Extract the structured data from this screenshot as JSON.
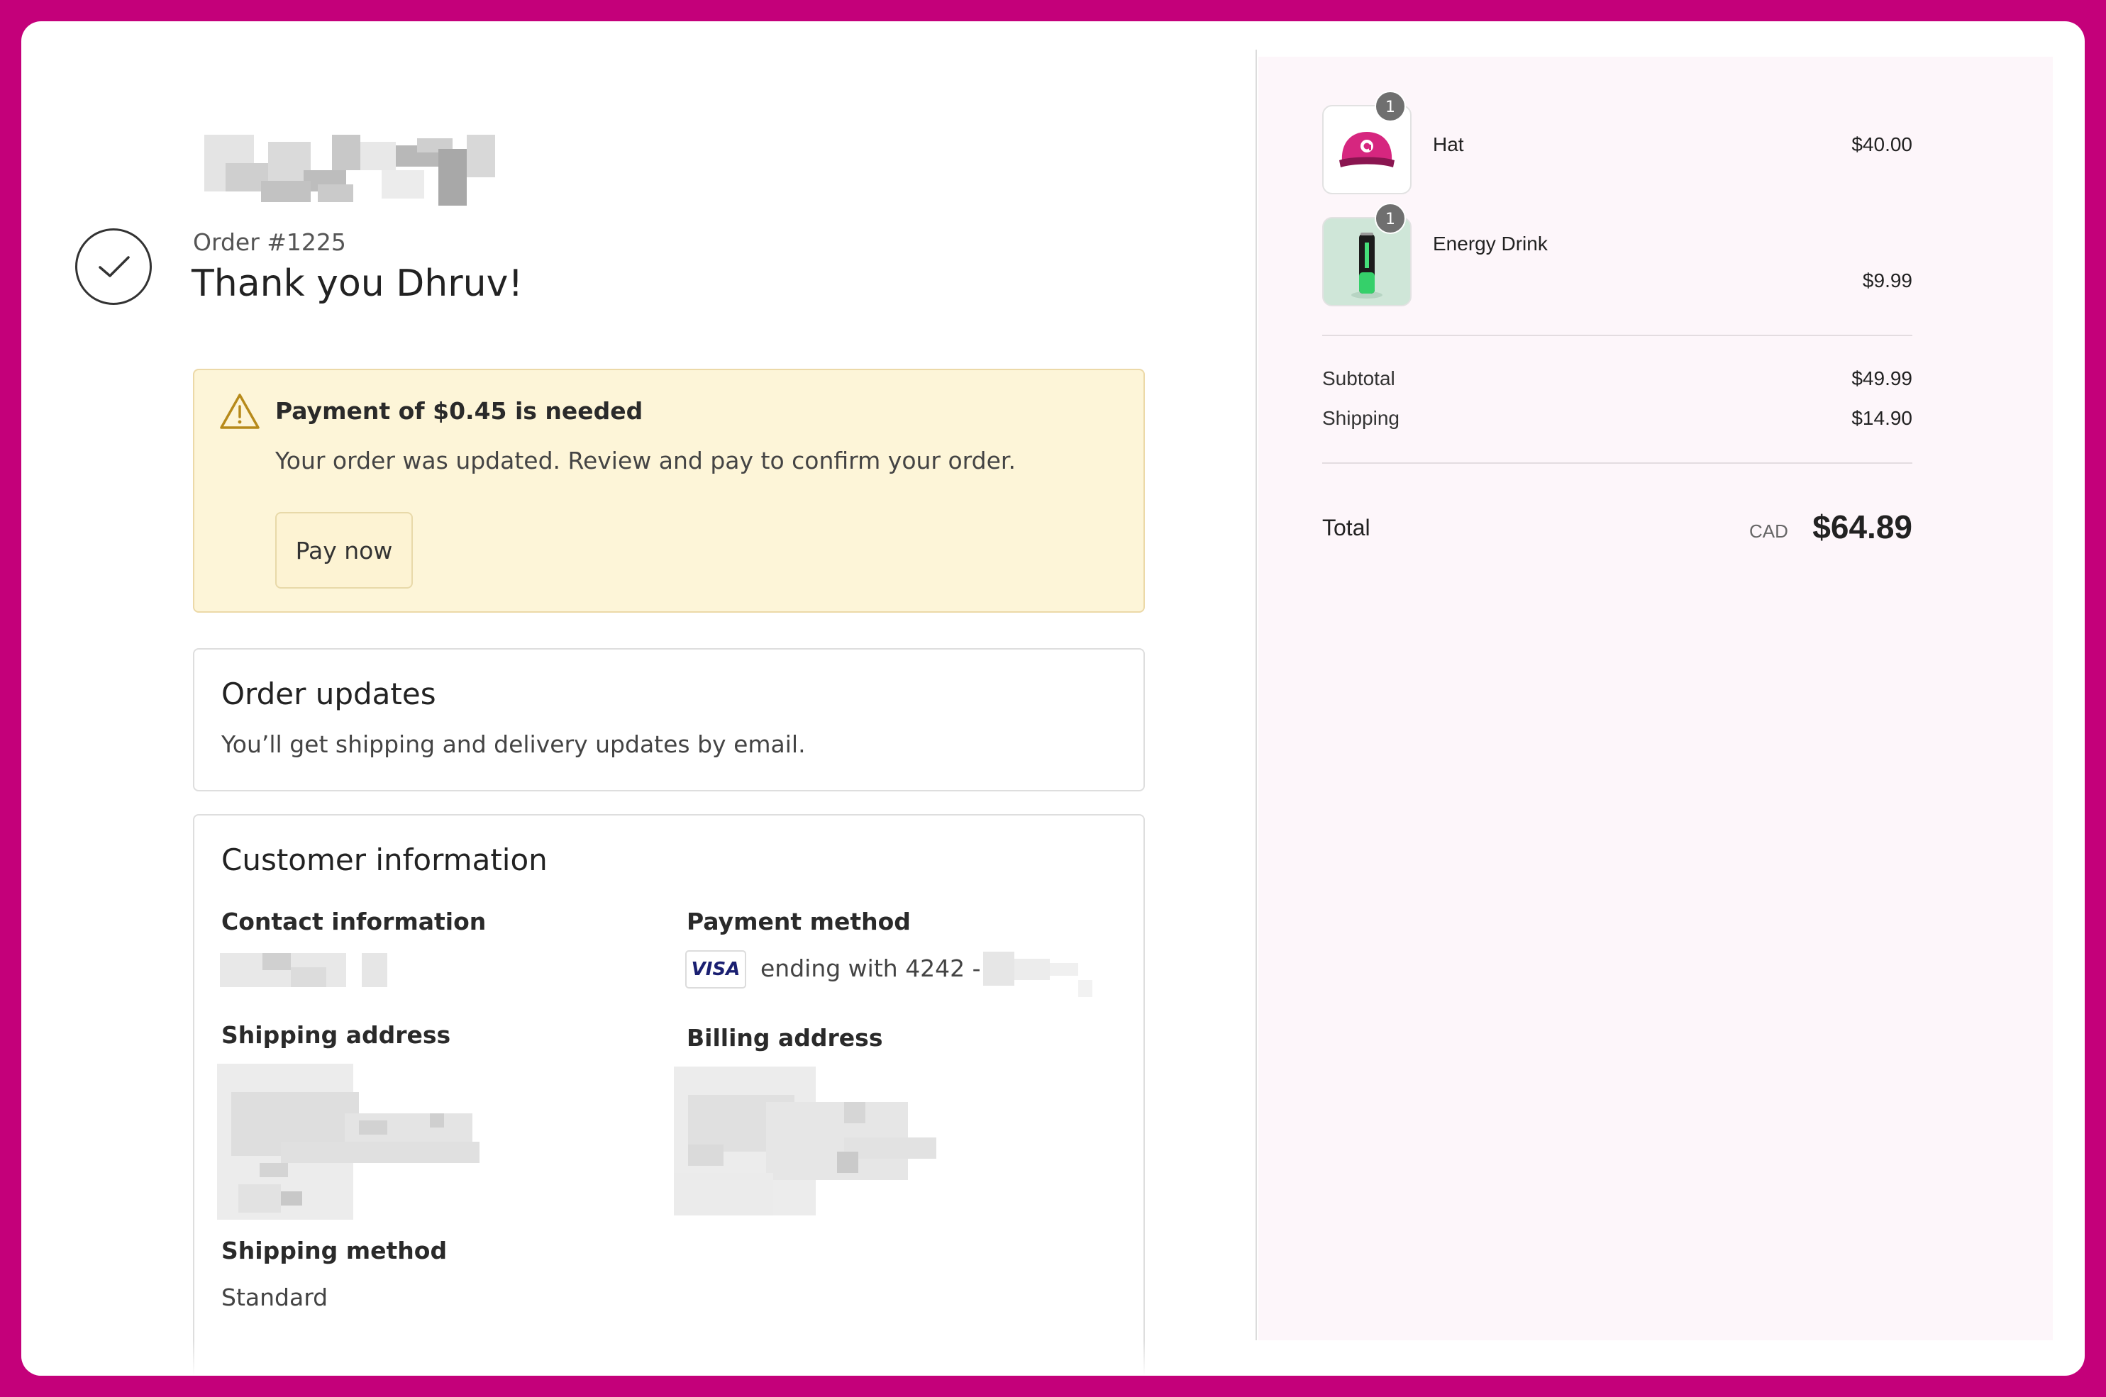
{
  "order": {
    "number": "Order #1225",
    "greeting": "Thank you Dhruv!"
  },
  "payment_alert": {
    "title": "Payment of $0.45 is needed",
    "description": "Your order was updated. Review and pay to confirm your order.",
    "button": "Pay now",
    "icon": "warning-triangle-icon"
  },
  "order_updates": {
    "heading": "Order updates",
    "text": "You’ll get shipping and delivery updates by email."
  },
  "customer": {
    "heading": "Customer information",
    "contact_label": "Contact information",
    "payment_label": "Payment method",
    "payment_brand": "VISA",
    "payment_text": "ending with 4242 -",
    "shipping_address_label": "Shipping address",
    "billing_address_label": "Billing address",
    "shipping_method_label": "Shipping method",
    "shipping_method_value": "Standard"
  },
  "cart": {
    "items": [
      {
        "name": "Hat",
        "price": "$40.00",
        "quantity": "1",
        "icon": "pink-cap-image"
      },
      {
        "name": "Energy Drink",
        "price": "$9.99",
        "quantity": "1",
        "icon": "energy-can-image"
      }
    ],
    "subtotal_label": "Subtotal",
    "subtotal": "$49.99",
    "shipping_label": "Shipping",
    "shipping": "$14.90",
    "total_label": "Total",
    "currency": "CAD",
    "total": "$64.89"
  },
  "colors": {
    "frame_background": "#c4007a",
    "alert_background": "#fdf5d8",
    "summary_background": "#fdf6fa",
    "cap_pink": "#d6267f"
  }
}
